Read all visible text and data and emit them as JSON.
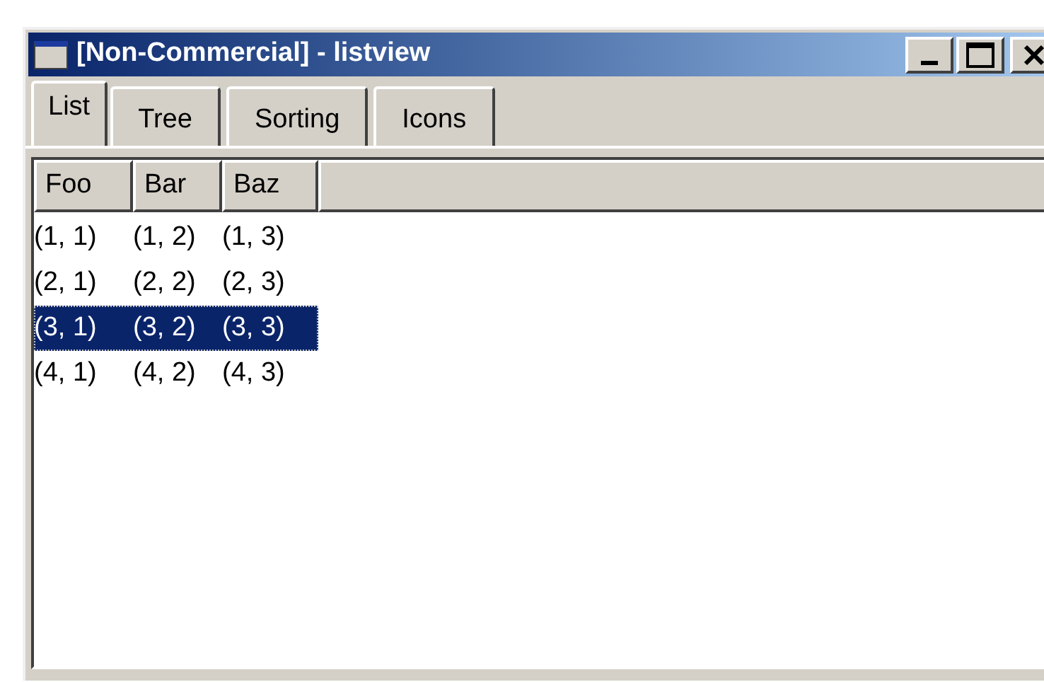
{
  "window": {
    "title": "[Non-Commercial] - listview"
  },
  "tabs": [
    {
      "label": "List",
      "selected": true
    },
    {
      "label": "Tree",
      "selected": false
    },
    {
      "label": "Sorting",
      "selected": false
    },
    {
      "label": "Icons",
      "selected": false
    }
  ],
  "table": {
    "columns": [
      "Foo",
      "Bar",
      "Baz"
    ],
    "rows": [
      {
        "cells": [
          "(1, 1)",
          "(1, 2)",
          "(1, 3)"
        ],
        "selected": false
      },
      {
        "cells": [
          "(2, 1)",
          "(2, 2)",
          "(2, 3)"
        ],
        "selected": false
      },
      {
        "cells": [
          "(3, 1)",
          "(3, 2)",
          "(3, 3)"
        ],
        "selected": true
      },
      {
        "cells": [
          "(4, 1)",
          "(4, 2)",
          "(4, 3)"
        ],
        "selected": false
      }
    ]
  }
}
